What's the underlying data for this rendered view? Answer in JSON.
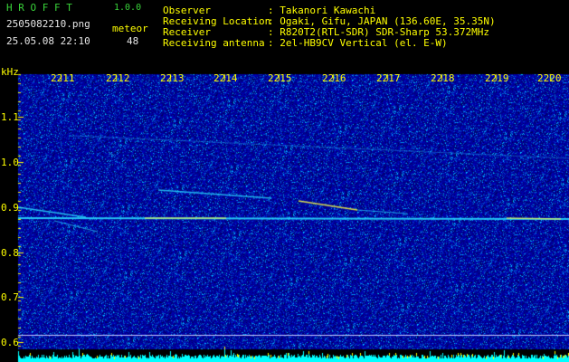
{
  "header": {
    "app_name": "H R O F F T",
    "version": "1.0.0",
    "filename": "2505082210.png",
    "timestamp": "25.05.08 22:10",
    "meteor_label": "meteor",
    "meteor_count": "48",
    "info_labels": [
      "Observer",
      "Receiving Location",
      "Receiver",
      "Receiving antenna"
    ],
    "info_values": [
      ": Takanori Kawachi",
      ": Ogaki, Gifu, JAPAN (136.60E, 35.35N)",
      ": R820T2(RTL-SDR) SDR-Sharp 53.372MHz",
      ": 2el-HB9CV Vertical (el. E-W)"
    ]
  },
  "axis": {
    "unit": "kHz",
    "y_ticks": [
      "1.1",
      "1.0",
      "0.9",
      "0.8",
      "0.7",
      "0.6"
    ],
    "x_ticks": [
      "2211",
      "2212",
      "2213",
      "2214",
      "2215",
      "2216",
      "2217",
      "2218",
      "2219",
      "2220"
    ]
  },
  "colors": {
    "header_green": "#39d33a",
    "header_white": "#e6e6e6",
    "header_yellow": "#ffff00",
    "background": "#00008a",
    "signal_cyan": "#29d9ff",
    "signal_yellow": "#ffff40",
    "bottom_bar_cyan": "#00ffff"
  }
}
